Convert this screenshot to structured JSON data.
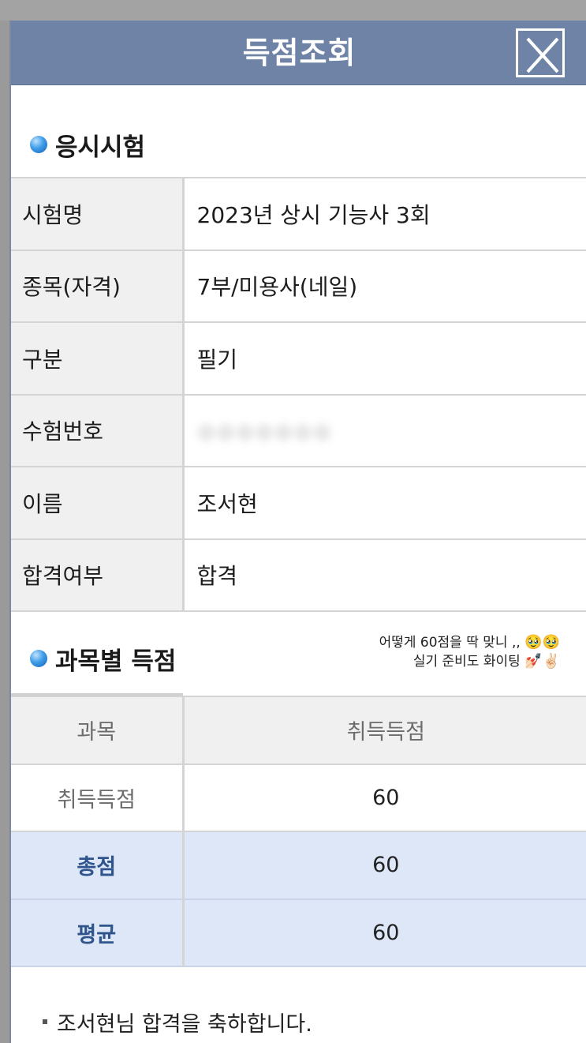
{
  "modal": {
    "title": "득점조회",
    "close_icon": "close-x-icon"
  },
  "exam_section": {
    "title": "응시시험",
    "rows": [
      {
        "label": "시험명",
        "value": "2023년 상시 기능사 3회"
      },
      {
        "label": "종목(자격)",
        "value": "7부/미용사(네일)"
      },
      {
        "label": "구분",
        "value": "필기"
      },
      {
        "label": "수험번호",
        "value": "●●●●●●●"
      },
      {
        "label": "이름",
        "value": "조서현"
      },
      {
        "label": "합격여부",
        "value": "합격"
      }
    ]
  },
  "score_section": {
    "title": "과목별 득점",
    "note_line1": "어떻게 60점을 딱 맞니 ,,",
    "note_line2": "실기 준비도 화이팅",
    "note_emoji1": "🥹🥹",
    "note_emoji2": "💅🏻✌🏻",
    "header": {
      "subject": "과목",
      "score": "취득득점"
    },
    "rows": [
      {
        "label": "취득득점",
        "value": "60"
      }
    ],
    "total": {
      "label": "총점",
      "value": "60"
    },
    "average": {
      "label": "평균",
      "value": "60"
    }
  },
  "footer": {
    "message": "조서현님 합격을 축하합니다."
  },
  "colors": {
    "header_bg": "#6e83a6",
    "summary_row_bg": "#dde7f8",
    "summary_label": "#2f558c"
  }
}
